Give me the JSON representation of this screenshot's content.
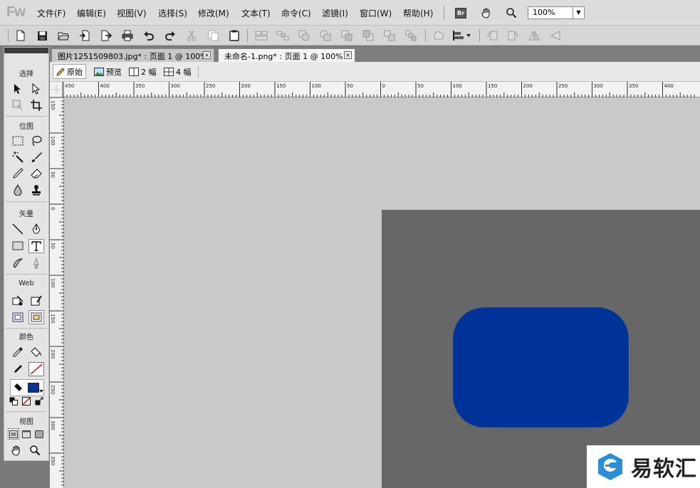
{
  "app": {
    "logo": "Fw",
    "menu": [
      "文件(F)",
      "编辑(E)",
      "视图(V)",
      "选择(S)",
      "修改(M)",
      "文本(T)",
      "命令(C)",
      "滤镜(I)",
      "窗口(W)",
      "帮助(H)"
    ],
    "bridge_label": "Br",
    "zoom_value": "100%"
  },
  "tools": {
    "sections": {
      "select": "选择",
      "bitmap": "位图",
      "vector": "矢量",
      "web": "Web",
      "colors": "颜色",
      "view": "视图"
    },
    "stroke_color": "#1f1f1f",
    "fill_color": "#0a3296"
  },
  "documents": {
    "tabs": [
      {
        "label": "图片1251509803.jpg* : 页面 1 @ 100%",
        "active": false
      },
      {
        "label": "未命名-1.png* : 页面 1 @ 100%",
        "active": true
      }
    ],
    "close_glyph": "×"
  },
  "view_modes": {
    "original": "原始",
    "preview": "预览",
    "two_up": "2 幅",
    "four_up": "4 幅"
  },
  "rulers": {
    "horizontal_labels": [
      "450",
      "400",
      "350",
      "300",
      "250",
      "200",
      "150",
      "100",
      "50",
      "0",
      "50",
      "100",
      "150",
      "200",
      "250",
      "300",
      "350",
      "400"
    ],
    "vertical_labels": [
      "150",
      "100",
      "50",
      "0",
      "50",
      "100",
      "150",
      "200",
      "250",
      "300",
      "350"
    ]
  },
  "canvas": {
    "background_color": "#c9c9c9",
    "document_color": "#676767",
    "shape_color": "#003399"
  },
  "watermark": {
    "text": "易软汇"
  }
}
